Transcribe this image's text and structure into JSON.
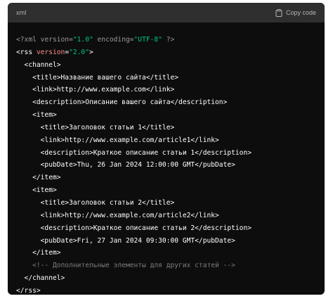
{
  "header": {
    "language": "xml",
    "copy_label": "Copy code",
    "copy_icon": "clipboard-icon"
  },
  "colors": {
    "background": "#0d0d0d",
    "header_bg": "#2f2f2f",
    "text": "#ffffff",
    "attribute": "#ff8c8c",
    "string": "#00c48a",
    "comment": "#7d7d7d"
  },
  "code_lines": [
    {
      "tokens": [
        {
          "text": "<?xml version=",
          "kind": "decl"
        },
        {
          "text": "\"1.0\"",
          "kind": "str"
        },
        {
          "text": " encoding=",
          "kind": "decl"
        },
        {
          "text": "\"UTF-8\"",
          "kind": "str"
        },
        {
          "text": " ?>",
          "kind": "decl"
        }
      ]
    },
    {
      "tokens": [
        {
          "text": "<rss ",
          "kind": "default"
        },
        {
          "text": "version",
          "kind": "attr"
        },
        {
          "text": "=",
          "kind": "default"
        },
        {
          "text": "\"2.0\"",
          "kind": "str"
        },
        {
          "text": ">",
          "kind": "default"
        }
      ]
    },
    {
      "tokens": [
        {
          "text": "  <channel>",
          "kind": "default"
        }
      ]
    },
    {
      "tokens": [
        {
          "text": "    <title>Название вашего сайта</title>",
          "kind": "default"
        }
      ]
    },
    {
      "tokens": [
        {
          "text": "    <link>http://www.example.com</link>",
          "kind": "default"
        }
      ]
    },
    {
      "tokens": [
        {
          "text": "    <description>Описание вашего сайта</description>",
          "kind": "default"
        }
      ]
    },
    {
      "tokens": [
        {
          "text": "    <item>",
          "kind": "default"
        }
      ]
    },
    {
      "tokens": [
        {
          "text": "      <title>Заголовок статьи 1</title>",
          "kind": "default"
        }
      ]
    },
    {
      "tokens": [
        {
          "text": "      <link>http://www.example.com/article1</link>",
          "kind": "default"
        }
      ]
    },
    {
      "tokens": [
        {
          "text": "      <description>Краткое описание статьи 1</description>",
          "kind": "default"
        }
      ]
    },
    {
      "tokens": [
        {
          "text": "      <pubDate>Thu, 26 Jan 2024 12:00:00 GMT</pubDate>",
          "kind": "default"
        }
      ]
    },
    {
      "tokens": [
        {
          "text": "    </item>",
          "kind": "default"
        }
      ]
    },
    {
      "tokens": [
        {
          "text": "    <item>",
          "kind": "default"
        }
      ]
    },
    {
      "tokens": [
        {
          "text": "      <title>Заголовок статьи 2</title>",
          "kind": "default"
        }
      ]
    },
    {
      "tokens": [
        {
          "text": "      <link>http://www.example.com/article2</link>",
          "kind": "default"
        }
      ]
    },
    {
      "tokens": [
        {
          "text": "      <description>Краткое описание статьи 2</description>",
          "kind": "default"
        }
      ]
    },
    {
      "tokens": [
        {
          "text": "      <pubDate>Fri, 27 Jan 2024 09:30:00 GMT</pubDate>",
          "kind": "default"
        }
      ]
    },
    {
      "tokens": [
        {
          "text": "    </item>",
          "kind": "default"
        }
      ]
    },
    {
      "tokens": [
        {
          "text": "    <!-- Дополнительные элементы для других статей -->",
          "kind": "comment"
        }
      ]
    },
    {
      "tokens": [
        {
          "text": "  </channel>",
          "kind": "default"
        }
      ]
    },
    {
      "tokens": [
        {
          "text": "</rss>",
          "kind": "default"
        }
      ]
    }
  ]
}
